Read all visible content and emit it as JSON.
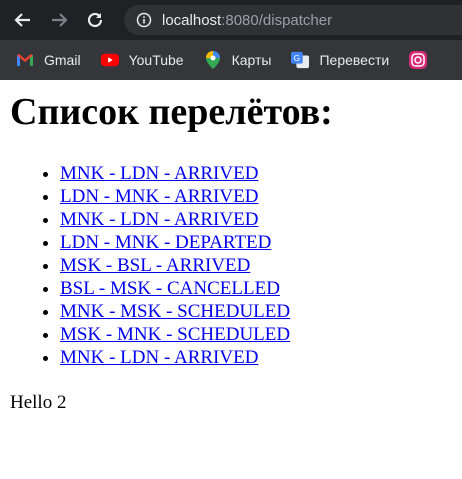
{
  "browser": {
    "url_host": "localhost",
    "url_rest": ":8080/dispatcher"
  },
  "bookmarks": [
    {
      "label": "Gmail",
      "icon": "gmail-icon"
    },
    {
      "label": "YouTube",
      "icon": "youtube-icon"
    },
    {
      "label": "Карты",
      "icon": "maps-icon"
    },
    {
      "label": "Перевести",
      "icon": "translate-icon"
    },
    {
      "label": "",
      "icon": "instagram-icon"
    }
  ],
  "page": {
    "title": "Список перелётов:",
    "flights": [
      "MNK - LDN - ARRIVED",
      "LDN - MNK - ARRIVED",
      "MNK - LDN - ARRIVED",
      "LDN - MNK - DEPARTED",
      "MSK - BSL - ARRIVED",
      "BSL - MSK - CANCELLED",
      "MNK - MSK - SCHEDULED",
      "MSK - MNK - SCHEDULED",
      "MNK - LDN - ARRIVED"
    ],
    "footer_text": "Hello 2"
  },
  "colors": {
    "link": "#0000ee",
    "chrome_bg": "#202124",
    "bookmarks_bg": "#35363a"
  }
}
